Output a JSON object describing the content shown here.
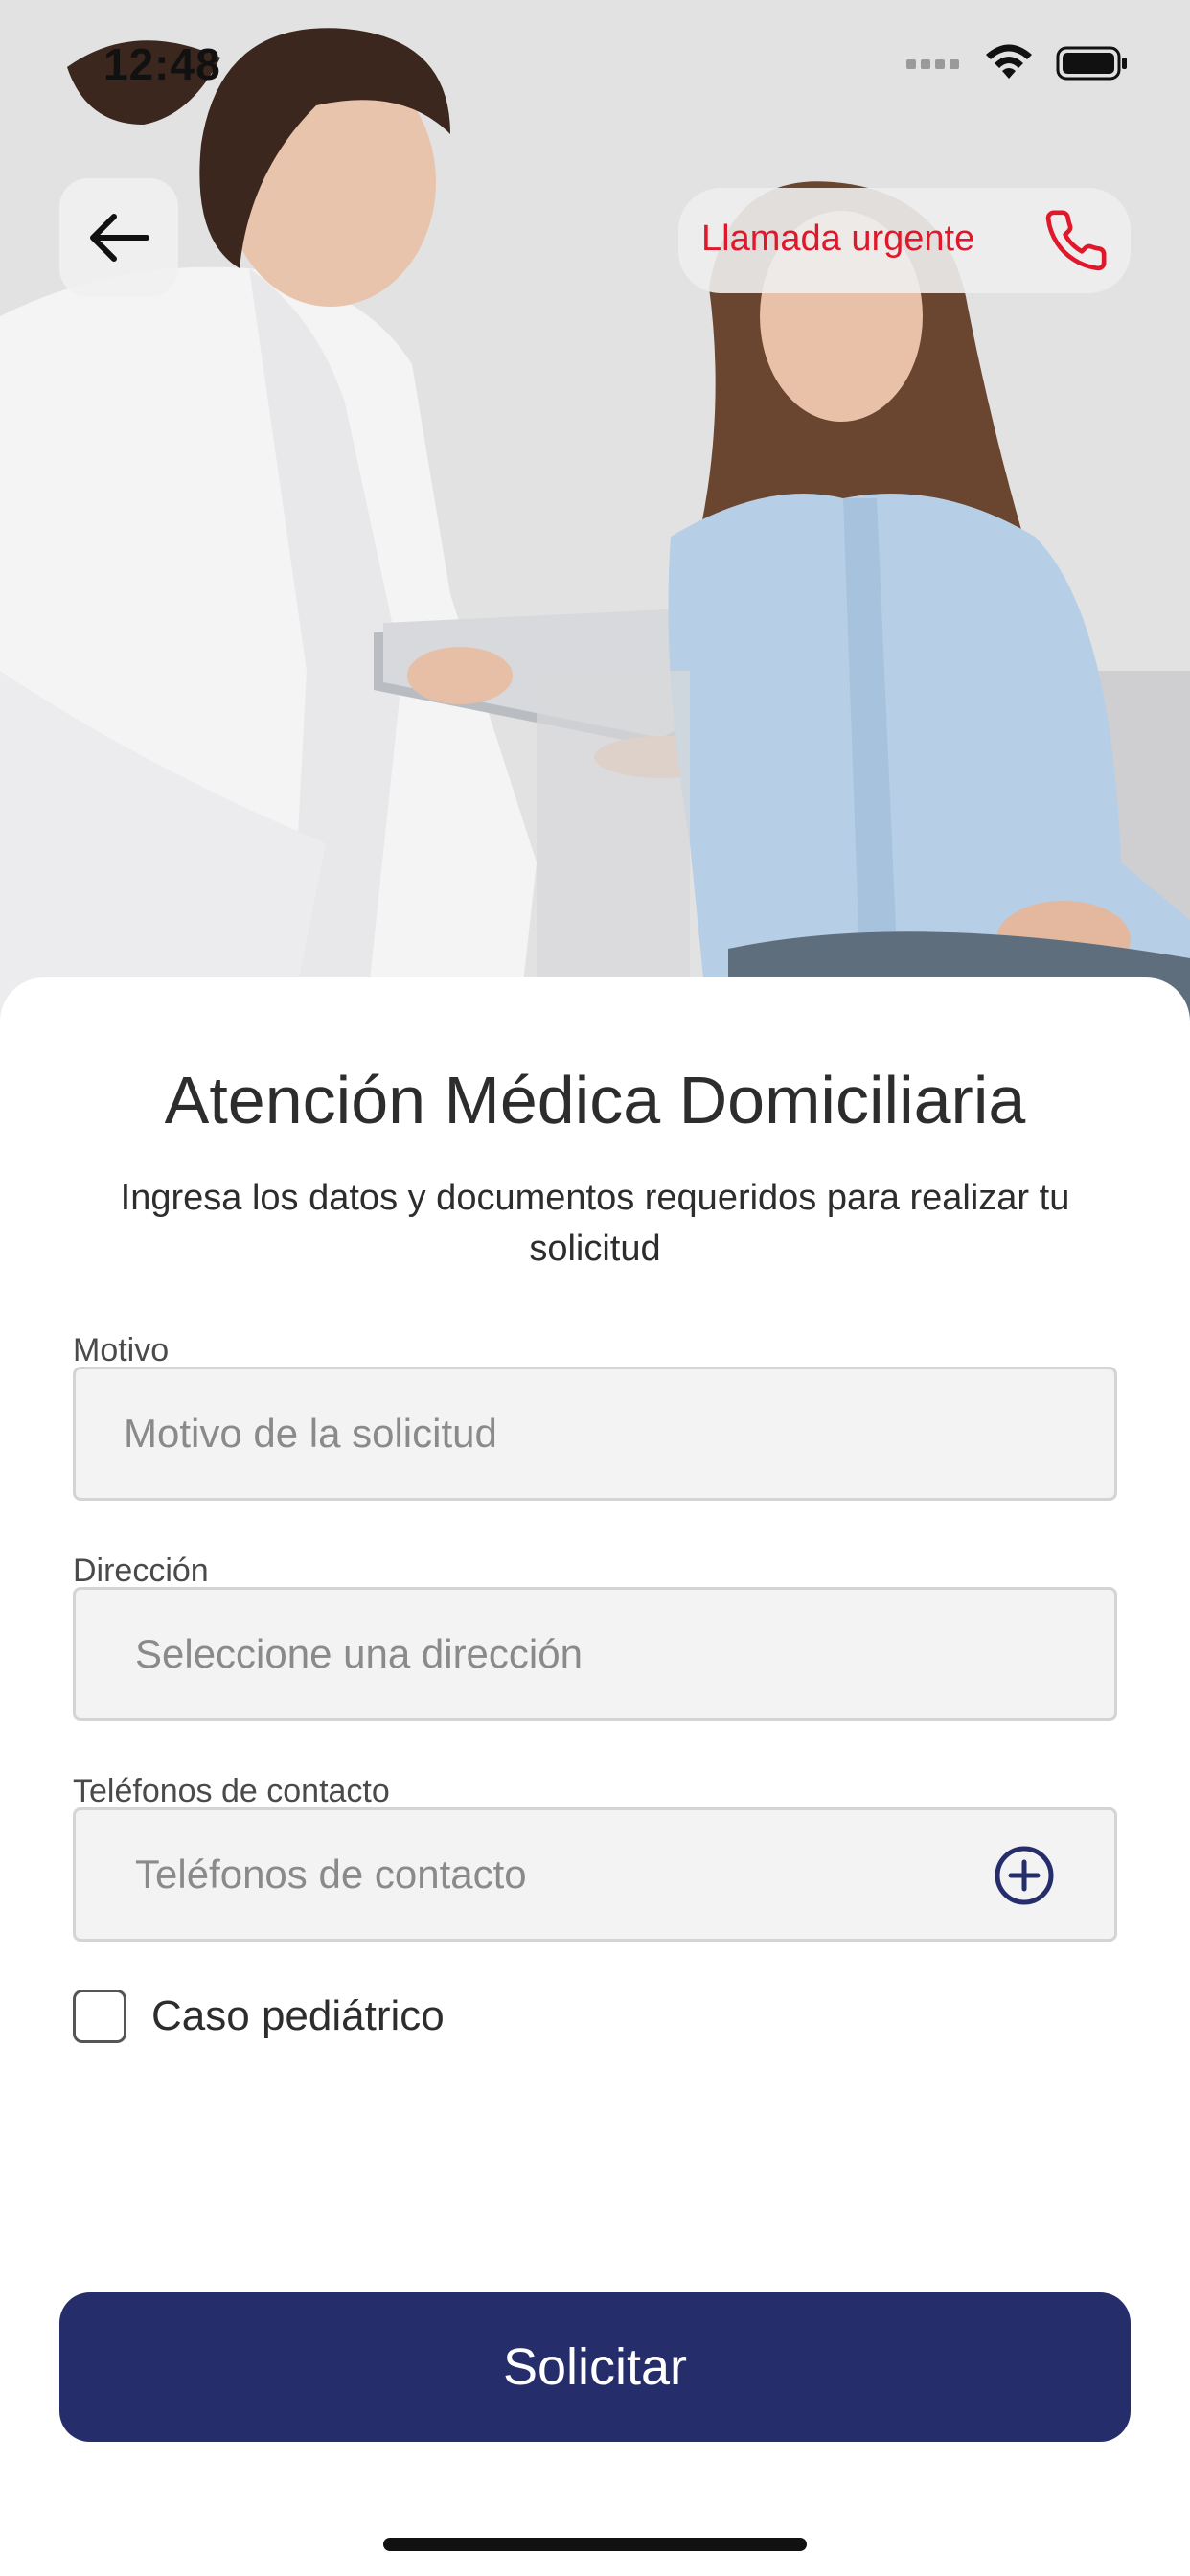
{
  "status_bar": {
    "time": "12:48"
  },
  "header": {
    "urgent_call_label": "Llamada urgente",
    "icons": {
      "back": "arrow-left-icon",
      "phone": "phone-icon"
    }
  },
  "main": {
    "title": "Atención Médica Domiciliaria",
    "subtitle": "Ingresa los datos y documentos requeridos para realizar tu solicitud"
  },
  "form": {
    "reason": {
      "label": "Motivo",
      "placeholder": "Motivo de la solicitud",
      "value": ""
    },
    "address": {
      "label": "Dirección",
      "placeholder": "Seleccione una dirección",
      "value": ""
    },
    "phones": {
      "label": "Teléfonos de contacto",
      "placeholder": "Teléfonos de contacto",
      "value": "",
      "icon": "plus-circle-icon"
    },
    "pediatric": {
      "label": "Caso pediátrico",
      "checked": false
    }
  },
  "actions": {
    "submit_label": "Solicitar"
  },
  "colors": {
    "brand_navy": "#262d6b",
    "urgent_red": "#e0182c",
    "field_bg": "#f3f3f3"
  }
}
